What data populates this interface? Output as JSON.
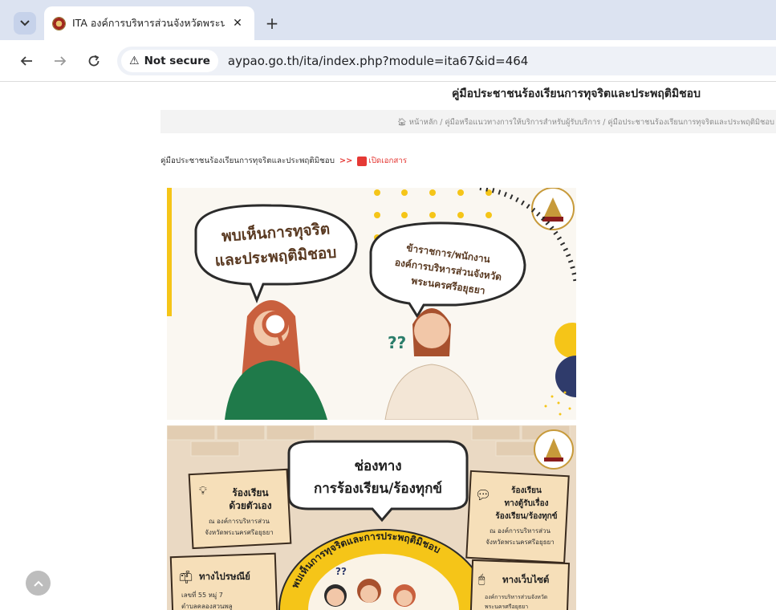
{
  "browser": {
    "tab_title": "ITA องค์การบริหารส่วนจังหวัดพระนครศรีอยุธยา",
    "tab_close": "✕",
    "new_tab": "+",
    "not_secure_label": "Not secure",
    "url": "aypao.go.th/ita/index.php?module=ita67&id=464"
  },
  "page": {
    "title": "คู่มือประชาชนร้องเรียนการทุจริตและประพฤติมิชอบ",
    "breadcrumb": "หน้าหลัก / คู่มือหรือแนวทางการให้บริการสำหรับผู้รับบริการ / คู่มือประชาชนร้องเรียนการทุจริตและประพฤติมิชอบ",
    "doc_label": "คู่มือประชาชนร้องเรียนการทุจริตและประพฤติมิชอบ",
    "doc_arrows": ">>",
    "open_doc": "เปิดเอกสาร"
  },
  "poster1": {
    "bubble_left_line1": "พบเห็นการทุจริต",
    "bubble_left_line2": "และประพฤติมิชอบ",
    "bubble_right_line1": "ข้าราชการ/พนักงาน",
    "bubble_right_line2": "องค์การบริหารส่วนจังหวัด",
    "bubble_right_line3": "พระนครศรีอยุธยา",
    "question": "??"
  },
  "poster2": {
    "heading_line1": "ช่องทาง",
    "heading_line2": "การร้องเรียน/ร้องทุกข์",
    "card1_title_line1": "ร้องเรียน",
    "card1_title_line2": "ด้วยตัวเอง",
    "card1_body_line1": "ณ องค์การบริหารส่วน",
    "card1_body_line2": "จังหวัดพระนครศรีอยุธยา",
    "card2_title_line1": "ร้องเรียน",
    "card2_title_line2": "ทางตู้รับเรื่อง",
    "card2_title_line3": "ร้องเรียน/ร้องทุกข์",
    "card2_body_line1": "ณ องค์การบริหารส่วน",
    "card2_body_line2": "จังหวัดพระนครศรีอยุธยา",
    "card3_title": "ทางไปรษณีย์",
    "card3_body_line1": "เลขที่ 55 หมู่ 7",
    "card3_body_line2": "ตำบลคลองสวนพลู",
    "card4_title": "ทางเว็บไซต์",
    "card4_body_line1": "องค์การบริหารส่วนจังหวัด",
    "card4_body_line2": "พระนครศรีอยุธยา",
    "arc_text": "พบเห็นการทุจริตและการประพฤติมิชอบ",
    "question": "??"
  },
  "icons": {
    "tab_list": "chevron-down-icon",
    "back": "back-arrow-icon",
    "forward": "forward-arrow-icon",
    "reload": "reload-icon",
    "warning": "warning-icon",
    "home": "home-icon",
    "pdf": "pdf-icon",
    "scroll_top": "chevron-up-icon"
  }
}
